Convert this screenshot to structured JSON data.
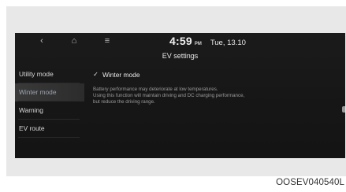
{
  "topbar": {
    "back_icon": "‹",
    "home_icon": "⌂",
    "menu_icon": "≡",
    "time": "4:59",
    "ampm": "PM",
    "date": "Tue, 13.10"
  },
  "title": "EV settings",
  "sidebar": {
    "items": [
      {
        "label": "Utility mode"
      },
      {
        "label": "Winter mode"
      },
      {
        "label": "Warning"
      },
      {
        "label": "EV route"
      }
    ]
  },
  "content": {
    "checkbox_label": "Winter mode",
    "checked": true,
    "check_glyph": "✓",
    "description": [
      "Battery performance may deteriorate at low temperatures.",
      "Using this function will maintain driving and DC charging performance,",
      "but reduce the driving range."
    ]
  },
  "caption": "OOSEV040540L"
}
